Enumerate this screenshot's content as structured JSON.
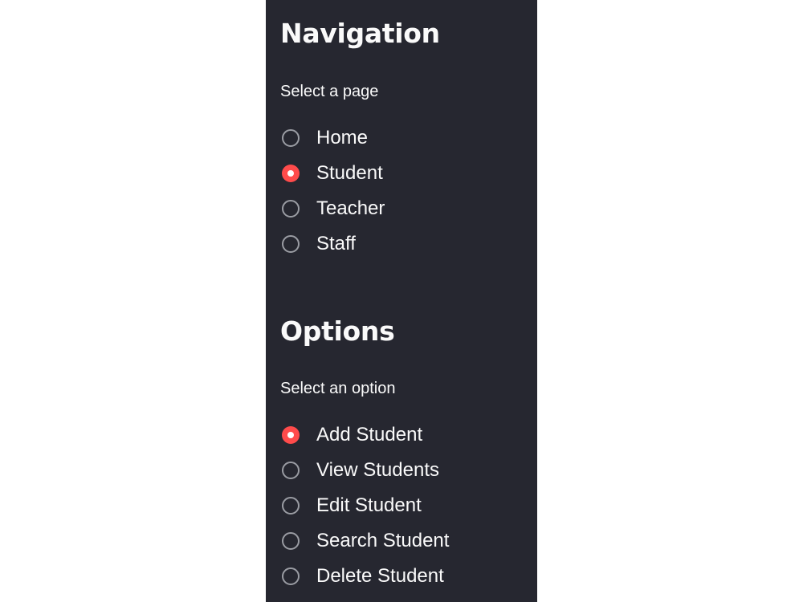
{
  "colors": {
    "sidebar_background": "#262730",
    "text": "#fafafa",
    "accent": "#ff4b4b",
    "radio_border": "#9a9ca3",
    "page_background": "#ffffff"
  },
  "navigation": {
    "title": "Navigation",
    "label": "Select a page",
    "selected": "Student",
    "items": [
      {
        "label": "Home",
        "checked": false
      },
      {
        "label": "Student",
        "checked": true
      },
      {
        "label": "Teacher",
        "checked": false
      },
      {
        "label": "Staff",
        "checked": false
      }
    ]
  },
  "options": {
    "title": "Options",
    "label": "Select an option",
    "selected": "Add Student",
    "items": [
      {
        "label": "Add Student",
        "checked": true
      },
      {
        "label": "View Students",
        "checked": false
      },
      {
        "label": "Edit Student",
        "checked": false
      },
      {
        "label": "Search Student",
        "checked": false
      },
      {
        "label": "Delete Student",
        "checked": false
      }
    ]
  }
}
